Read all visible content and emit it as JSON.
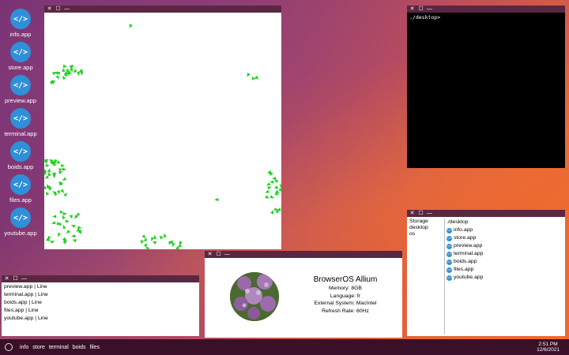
{
  "desktop_icons": [
    {
      "label": "info.app",
      "glyph": "</>"
    },
    {
      "label": "store.app",
      "glyph": "</>"
    },
    {
      "label": "preview.app",
      "glyph": "</>"
    },
    {
      "label": "terminal.app",
      "glyph": "</>"
    },
    {
      "label": "boids.app",
      "glyph": "</>"
    },
    {
      "label": "files.app",
      "glyph": "</>"
    },
    {
      "label": "youtube.app",
      "glyph": "</>"
    }
  ],
  "window_controls": {
    "close": "✕",
    "maximize": "☐",
    "minimize": "—"
  },
  "terminal": {
    "prompt": "./desktop>"
  },
  "files": {
    "sidebar": [
      "Storage",
      "desktop",
      "os"
    ],
    "path": "./desktop",
    "items": [
      "info.app",
      "store.app",
      "preview.app",
      "terminal.app",
      "boids.app",
      "files.app",
      "youtube.app"
    ]
  },
  "info": {
    "title": "BrowserOS Allium",
    "lines": [
      "Memory: 8GB",
      "Language: fr",
      "External System: MacIntel",
      "Refresh Rate: 60Hz"
    ]
  },
  "log": {
    "lines": [
      "preview.app | Line",
      "terminal.app | Line",
      "boids.app | Line",
      "files.app | Line",
      "youtube.app | Line"
    ]
  },
  "taskbar": {
    "items": [
      "info",
      "store",
      "terminal",
      "boids",
      "files"
    ],
    "time": "2:51 PM",
    "date": "12/6/2021"
  },
  "colors": {
    "accent": "#2f8fd8",
    "boid": "#1fd11f",
    "titlebar": "#5a2742",
    "taskbar": "#3a1028"
  }
}
